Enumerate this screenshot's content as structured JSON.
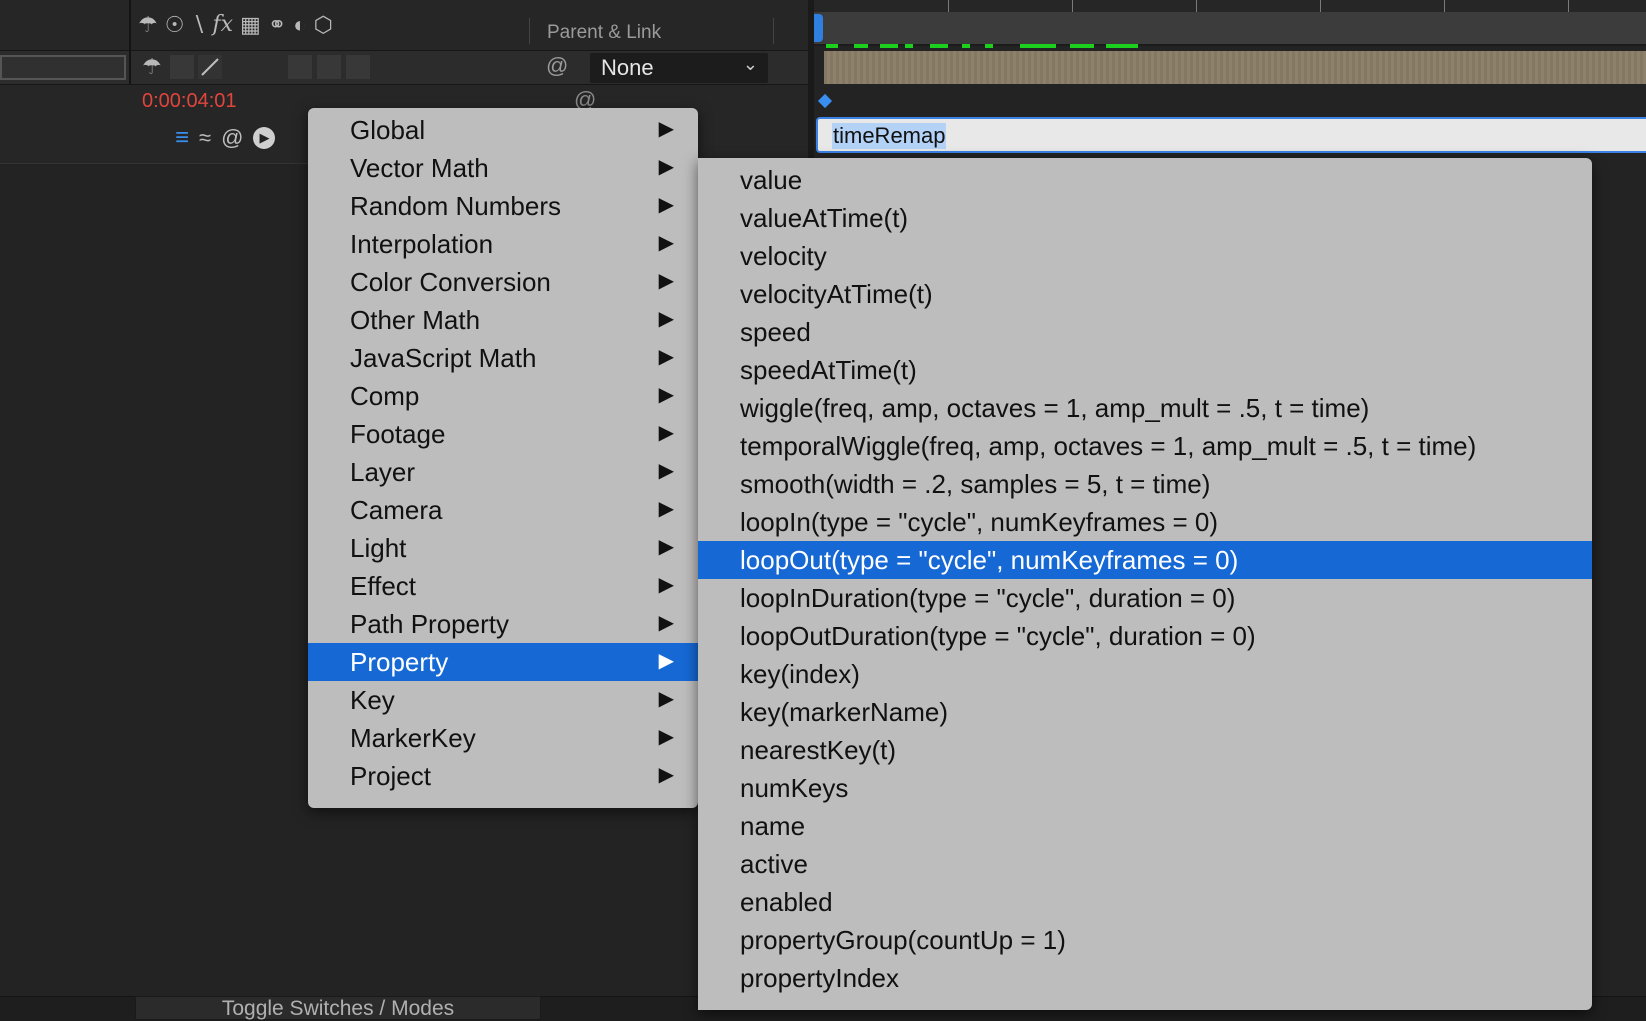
{
  "header": {
    "parent_link_label": "Parent & Link",
    "switch_icons": [
      "shy-icon",
      "collapse-transform-icon",
      "quality-icon",
      "fx-icon",
      "frame-blend-icon",
      "motion-blur-icon",
      "adjustment-layer-icon",
      "3d-layer-icon"
    ]
  },
  "layer": {
    "parent_value": "None",
    "time": "0:00:04:01"
  },
  "property_row": {
    "icons": [
      "equals-icon",
      "graph-icon",
      "pickwhip-icon",
      "expression-menu-icon"
    ]
  },
  "expression": {
    "text": "timeRemap"
  },
  "menu": {
    "categories": [
      {
        "label": "Global"
      },
      {
        "label": "Vector Math"
      },
      {
        "label": "Random Numbers"
      },
      {
        "label": "Interpolation"
      },
      {
        "label": "Color Conversion"
      },
      {
        "label": "Other Math"
      },
      {
        "label": "JavaScript Math"
      },
      {
        "label": "Comp"
      },
      {
        "label": "Footage"
      },
      {
        "label": "Layer"
      },
      {
        "label": "Camera"
      },
      {
        "label": "Light"
      },
      {
        "label": "Effect"
      },
      {
        "label": "Path Property"
      },
      {
        "label": "Property"
      },
      {
        "label": "Key"
      },
      {
        "label": "MarkerKey"
      },
      {
        "label": "Project"
      }
    ],
    "selected_category": "Property",
    "submenu": [
      {
        "label": "value"
      },
      {
        "label": "valueAtTime(t)"
      },
      {
        "label": "velocity"
      },
      {
        "label": "velocityAtTime(t)"
      },
      {
        "label": "speed"
      },
      {
        "label": "speedAtTime(t)"
      },
      {
        "label": "wiggle(freq, amp, octaves = 1, amp_mult = .5, t = time)"
      },
      {
        "label": "temporalWiggle(freq, amp, octaves = 1, amp_mult = .5, t = time)"
      },
      {
        "label": "smooth(width = .2, samples = 5, t = time)"
      },
      {
        "label": "loopIn(type = \"cycle\", numKeyframes = 0)"
      },
      {
        "label": "loopOut(type = \"cycle\", numKeyframes = 0)"
      },
      {
        "label": "loopInDuration(type = \"cycle\", duration = 0)"
      },
      {
        "label": "loopOutDuration(type = \"cycle\", duration = 0)"
      },
      {
        "label": "key(index)"
      },
      {
        "label": "key(markerName)"
      },
      {
        "label": "nearestKey(t)"
      },
      {
        "label": "numKeys"
      },
      {
        "label": "name"
      },
      {
        "label": "active"
      },
      {
        "label": "enabled"
      },
      {
        "label": "propertyGroup(countUp = 1)"
      },
      {
        "label": "propertyIndex"
      }
    ],
    "selected_submenu_item": "loopOut(type = \"cycle\", numKeyframes = 0)"
  },
  "footer": {
    "toggle_label": "Toggle Switches / Modes"
  },
  "colors": {
    "time": "#e0453c",
    "highlight": "#1668d4",
    "playhead": "#2f7fe0",
    "cache": "#1ed01e"
  }
}
